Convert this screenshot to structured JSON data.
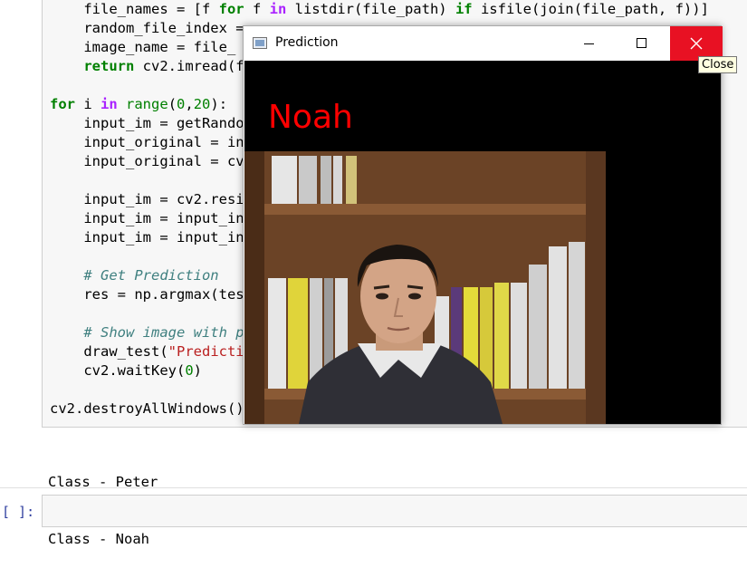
{
  "notebook": {
    "code_lines": [
      [
        {
          "t": "    file_names = [f ",
          "c": ""
        },
        {
          "t": "for",
          "c": "kw"
        },
        {
          "t": " f ",
          "c": ""
        },
        {
          "t": "in",
          "c": "op"
        },
        {
          "t": " listdir(file_path) ",
          "c": ""
        },
        {
          "t": "if",
          "c": "kw"
        },
        {
          "t": " isfile(join(file_path, f))]",
          "c": ""
        }
      ],
      [
        {
          "t": "    random_file_index = ",
          "c": ""
        }
      ],
      [
        {
          "t": "    image_name = file_",
          "c": ""
        }
      ],
      [
        {
          "t": "    ",
          "c": ""
        },
        {
          "t": "return",
          "c": "kw"
        },
        {
          "t": " cv2.imread(f",
          "c": ""
        }
      ],
      [
        {
          "t": "",
          "c": ""
        }
      ],
      [
        {
          "t": "for",
          "c": "kw"
        },
        {
          "t": " i ",
          "c": ""
        },
        {
          "t": "in",
          "c": "op"
        },
        {
          "t": " ",
          "c": ""
        },
        {
          "t": "range",
          "c": "bi"
        },
        {
          "t": "(",
          "c": ""
        },
        {
          "t": "0",
          "c": "num"
        },
        {
          "t": ",",
          "c": ""
        },
        {
          "t": "20",
          "c": "num"
        },
        {
          "t": "):",
          "c": ""
        }
      ],
      [
        {
          "t": "    input_im = getRando",
          "c": ""
        }
      ],
      [
        {
          "t": "    input_original = in",
          "c": ""
        }
      ],
      [
        {
          "t": "    input_original = cv                                          lati",
          "c": ""
        }
      ],
      [
        {
          "t": "",
          "c": ""
        }
      ],
      [
        {
          "t": "    input_im = cv2.resi                                           EAR)",
          "c": ""
        }
      ],
      [
        {
          "t": "    input_im = input_in",
          "c": ""
        }
      ],
      [
        {
          "t": "    input_im = input_in",
          "c": ""
        }
      ],
      [
        {
          "t": "",
          "c": ""
        }
      ],
      [
        {
          "t": "    ",
          "c": ""
        },
        {
          "t": "# Get Prediction",
          "c": "cm"
        }
      ],
      [
        {
          "t": "    res = np.argmax(tes",
          "c": ""
        }
      ],
      [
        {
          "t": "",
          "c": ""
        }
      ],
      [
        {
          "t": "    ",
          "c": ""
        },
        {
          "t": "# Show image with p",
          "c": "cm"
        }
      ],
      [
        {
          "t": "    draw_test(",
          "c": ""
        },
        {
          "t": "\"Predicti",
          "c": "str"
        }
      ],
      [
        {
          "t": "    cv2.waitKey(",
          "c": ""
        },
        {
          "t": "0",
          "c": "num"
        },
        {
          "t": ")",
          "c": ""
        }
      ],
      [
        {
          "t": "",
          "c": ""
        }
      ],
      [
        {
          "t": "cv2.destroyAllWindows()",
          "c": ""
        }
      ]
    ],
    "output_lines": [
      "Class - Peter",
      "Class - Noah"
    ],
    "empty_prompt": "[ ]:"
  },
  "window": {
    "title": "Prediction",
    "prediction_label": "Noah",
    "close_tooltip": "Close"
  },
  "colors": {
    "close_button": "#e81123",
    "prediction_text": "#ff0000",
    "keyword": "#008000",
    "comment": "#408080",
    "string": "#ba2121"
  }
}
